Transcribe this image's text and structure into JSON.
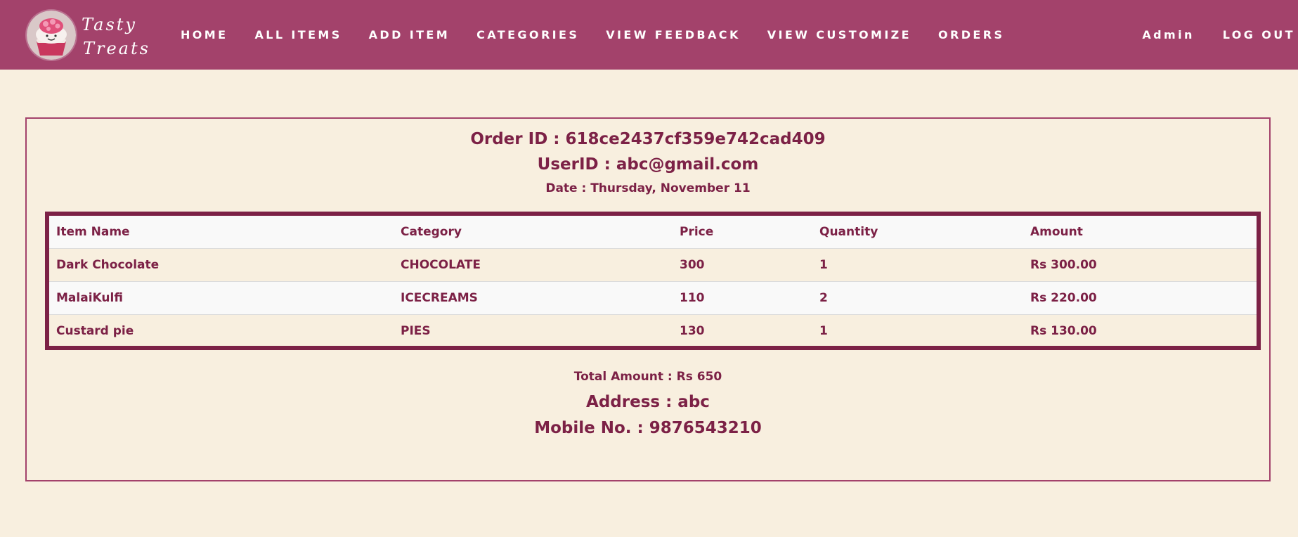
{
  "navbar": {
    "brand_line1": "Tasty",
    "brand_line2": "Treats",
    "logo_icon": "cupcake-logo",
    "links": [
      "HOME",
      "ALL ITEMS",
      "ADD ITEM",
      "CATEGORIES",
      "VIEW FEEDBACK",
      "VIEW CUSTOMIZE",
      "ORDERS"
    ],
    "user_label": "Admin",
    "logout_label": "LOG OUT"
  },
  "order": {
    "order_id": "Order ID : 618ce2437cf359e742cad409",
    "user_id": "UserID : abc@gmail.com",
    "date": "Date : Thursday, November 11",
    "columns": [
      "Item Name",
      "Category",
      "Price",
      "Quantity",
      "Amount"
    ],
    "rows": [
      [
        "Dark Chocolate",
        "CHOCOLATE",
        "300",
        "1",
        "Rs 300.00"
      ],
      [
        "MalaiKulfi",
        "ICECREAMS",
        "110",
        "2",
        "Rs 220.00"
      ],
      [
        "Custard pie",
        "PIES",
        "130",
        "1",
        "Rs 130.00"
      ]
    ],
    "total": "Total Amount : Rs 650",
    "address": "Address : abc",
    "mobile": "Mobile No. : 9876543210"
  },
  "colors": {
    "navbar_bg": "#a3426b",
    "page_bg": "#f8efdf",
    "text": "#7c2146",
    "table_border": "#7c2146"
  }
}
